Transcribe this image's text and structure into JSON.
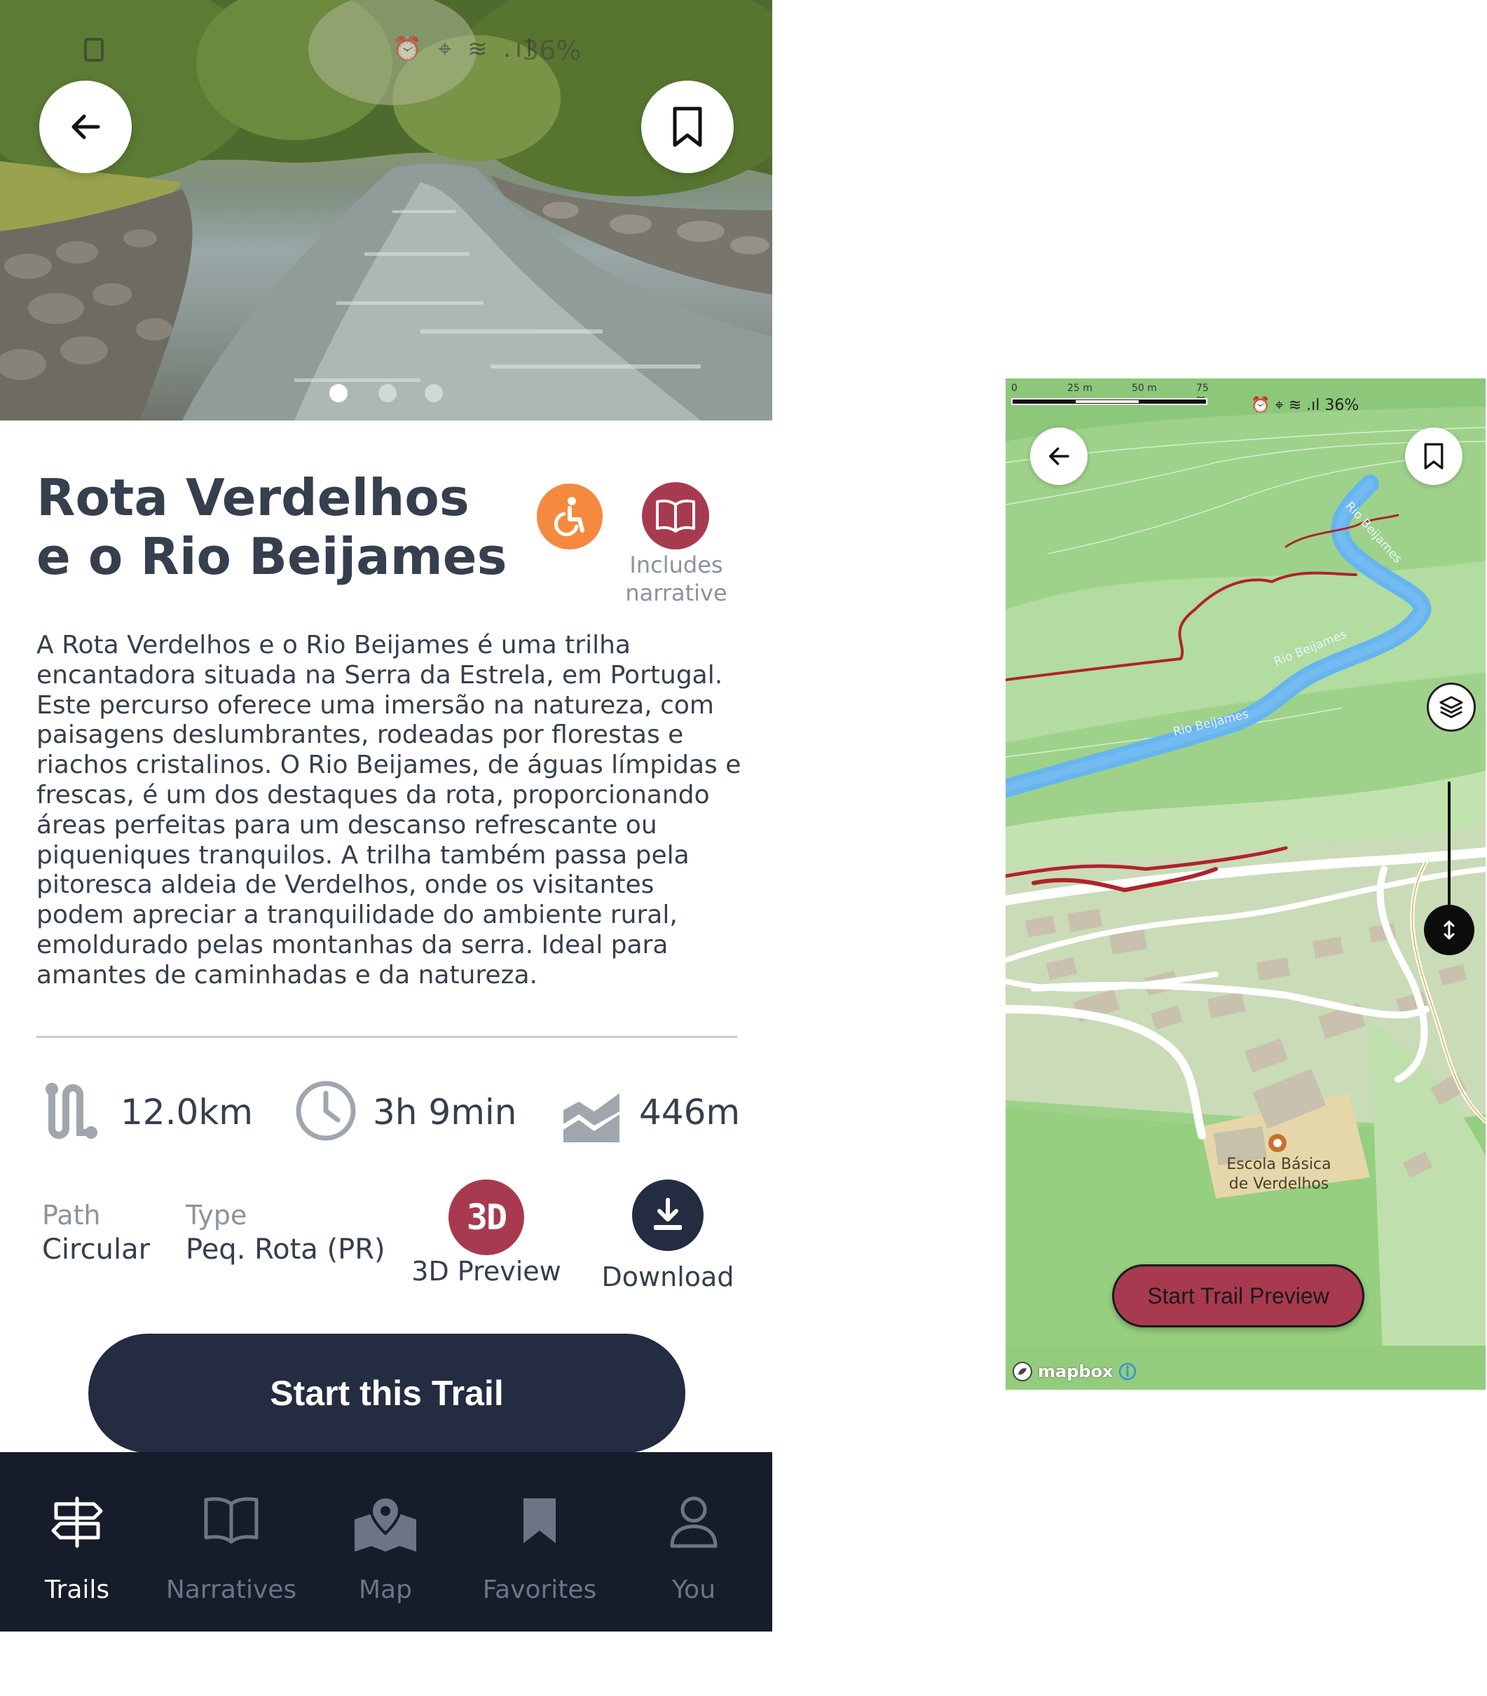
{
  "left": {
    "status": {
      "icons": "⏰ ⌖ ≋ .ıl",
      "battery": "36%"
    },
    "carousel": {
      "count": 3,
      "active": 0
    },
    "title": "Rota Verdelhos e o Rio Beijames",
    "badges": {
      "narrative_label": "Includes narrative"
    },
    "description": "A Rota Verdelhos e o Rio Beijames é uma trilha encantadora situada na Serra da Estrela, em Portugal. Este percurso oferece uma imersão na natureza, com paisagens deslumbrantes, rodeadas por florestas e riachos cristalinos. O Rio Beijames, de águas límpidas e frescas, é um dos destaques da rota, proporcionando áreas perfeitas para um descanso refrescante ou piqueniques tranquilos. A trilha também passa pela pitoresca aldeia de Verdelhos, onde os visitantes podem apreciar a tranquilidade do ambiente rural, emoldurado pelas montanhas da serra. Ideal para amantes de caminhadas e da natureza.",
    "stats": {
      "distance": "12.0km",
      "duration": "3h 9min",
      "elevation": "446m"
    },
    "meta": {
      "path_label": "Path",
      "path_value": "Circular",
      "type_label": "Type",
      "type_value": "Peq. Rota (PR)"
    },
    "actions": {
      "preview_icon_text": "3D",
      "preview_label": "3D Preview",
      "download_label": "Download"
    },
    "start_button": "Start this Trail",
    "nav": [
      {
        "label": "Trails",
        "icon": "signpost-icon",
        "active": true
      },
      {
        "label": "Narratives",
        "icon": "book-icon",
        "active": false
      },
      {
        "label": "Map",
        "icon": "map-icon",
        "active": false
      },
      {
        "label": "Favorites",
        "icon": "bookmark-icon",
        "active": false
      },
      {
        "label": "You",
        "icon": "user-icon",
        "active": false
      }
    ],
    "colors": {
      "navy": "#232c40",
      "accent_red": "#a83a4f",
      "accessible_orange": "#f5893e"
    }
  },
  "right": {
    "scale": {
      "l0": "0",
      "l1": "25 m",
      "l2": "50 m",
      "l3": "75 m"
    },
    "status": {
      "icons": "⏰ ⌖ ≋ .ıl",
      "battery": "36%"
    },
    "river_labels": {
      "a": "Rio Beijames",
      "b": "Rio Beijames",
      "c": "Rio Beijames"
    },
    "school": "Escola Básica de Verdelhos",
    "start_preview": "Start Trail Preview",
    "attribution": "mapbox",
    "colors": {
      "map_green": "#9ed28a",
      "river": "#66b5ee",
      "trail": "#b0232b"
    }
  }
}
